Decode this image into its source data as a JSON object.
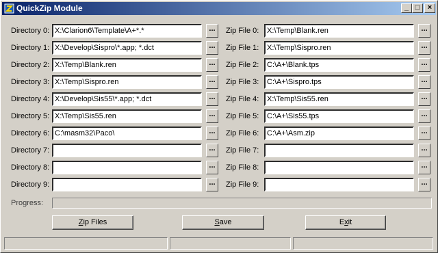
{
  "window": {
    "title": "QuickZip Module"
  },
  "title_controls": {
    "minimize": "_",
    "maximize": "□",
    "close": "×"
  },
  "directory_labels": [
    "Directory 0:",
    "Directory 1:",
    "Directory 2:",
    "Directory 3:",
    "Directory 4:",
    "Directory 5:",
    "Directory 6:",
    "Directory 7:",
    "Directory 8:",
    "Directory 9:"
  ],
  "directory_values": [
    "X:\\Clarion6\\Template\\A+*.*",
    "X:\\Develop\\Sispro\\*.app; *.dct",
    "X:\\Temp\\Blank.ren",
    "X:\\Temp\\Sispro.ren",
    "X:\\Develop\\Sis55\\*.app; *.dct",
    "X:\\Temp\\Sis55.ren",
    "C:\\masm32\\Paco\\",
    "",
    "",
    ""
  ],
  "zip_labels": [
    "Zip  File 0:",
    "Zip  File 1:",
    "Zip  File 2:",
    "Zip  File 3:",
    "Zip  File 4:",
    "Zip  File 5:",
    "Zip  File 6:",
    "Zip  File 7:",
    "Zip  File 8:",
    "Zip  File 9:"
  ],
  "zip_values": [
    "X:\\Temp\\Blank.ren",
    "X:\\Temp\\Sispro.ren",
    "C:\\A+\\Blank.tps",
    "C:\\A+\\Sispro.tps",
    "X:\\Temp\\Sis55.ren",
    "C:\\A+\\Sis55.tps",
    "C:\\A+\\Asm.zip",
    "",
    "",
    ""
  ],
  "browse_label": "...",
  "progress": {
    "label": "Progress:",
    "value": 0
  },
  "buttons": {
    "zip_hotkey": "Z",
    "zip_rest": "ip Files",
    "save_hotkey": "S",
    "save_rest": "ave",
    "exit_pre": "E",
    "exit_hotkey": "x",
    "exit_post": "it"
  }
}
